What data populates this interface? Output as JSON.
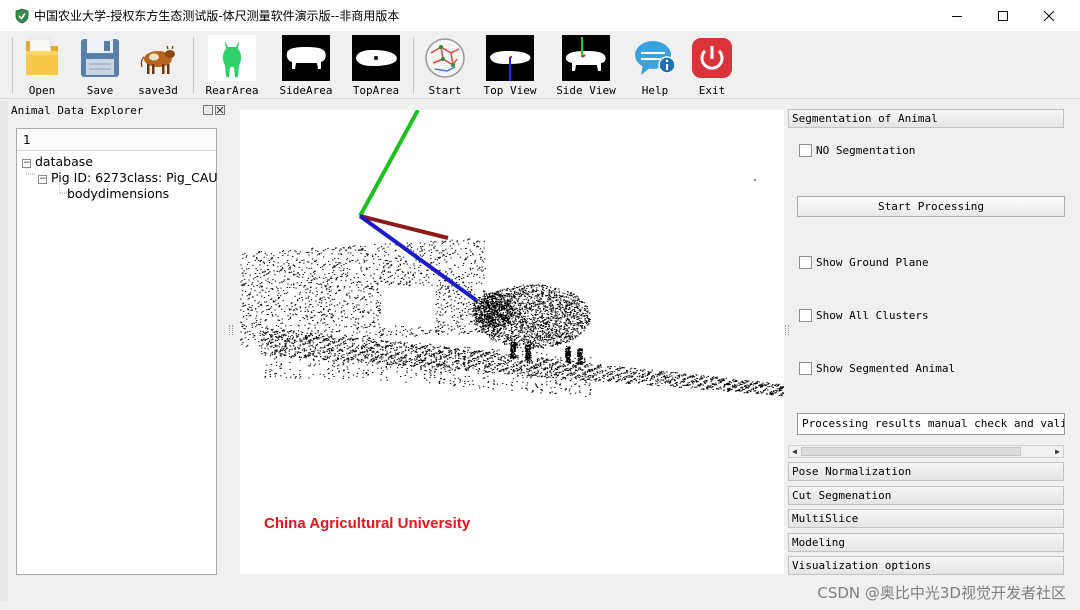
{
  "window": {
    "title": "中国农业大学-授权东方生态测试版-体尺测量软件演示版--非商用版本",
    "controls": [
      "minimize",
      "maximize",
      "close"
    ]
  },
  "toolbar": {
    "buttons": [
      {
        "label": "Open",
        "icon": "folder-icon"
      },
      {
        "label": "Save",
        "icon": "floppy-disk-icon"
      },
      {
        "label": "save3d",
        "icon": "cow-icon"
      },
      {
        "label": "RearArea",
        "icon": "pig-rear-icon"
      },
      {
        "label": "SideArea",
        "icon": "pig-side-icon"
      },
      {
        "label": "TopArea",
        "icon": "pig-top-icon"
      },
      {
        "label": "Start",
        "icon": "network-graph-icon"
      },
      {
        "label": "Top View",
        "icon": "top-view-axes-icon"
      },
      {
        "label": "Side View",
        "icon": "side-view-axes-icon"
      },
      {
        "label": "Help",
        "icon": "help-chat-icon"
      },
      {
        "label": "Exit",
        "icon": "power-icon"
      }
    ]
  },
  "explorer": {
    "title": "Animal Data Explorer",
    "column_header": "1",
    "tree": {
      "root": "database",
      "child": "Pig  ID: 6273class: Pig_CAU",
      "leaf": "bodydimensions"
    }
  },
  "viewport": {
    "watermark": "China Agricultural University",
    "watermark_color": "#e8141b",
    "axis_colors": {
      "x": "#8b1a1a",
      "y": "#1ec01e",
      "z": "#1a1ac8"
    }
  },
  "right_panel": {
    "sections": [
      "Segmentation of Animal",
      "Pose Normalization",
      "Cut Segmenation",
      "MultiSlice",
      "Modeling",
      "Visualization options"
    ],
    "checkboxes": {
      "no_segmentation": "NO Segmentation",
      "show_ground_plane": "Show Ground Plane",
      "show_all_clusters": "Show All Clusters",
      "show_segmented_animal": "Show Segmented Animal"
    },
    "start_processing": "Start Processing",
    "results_field": "Processing results manual check and valida"
  },
  "footer": {
    "watermark": "CSDN @奥比中光3D视觉开发者社区"
  }
}
